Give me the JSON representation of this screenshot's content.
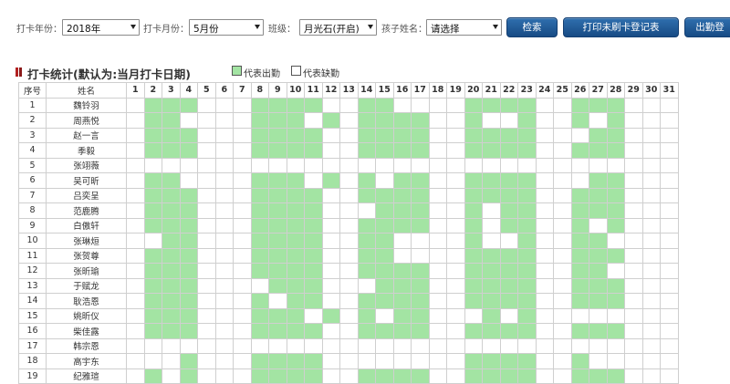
{
  "filters": {
    "year_label": "打卡年份：",
    "year_value": "2018年",
    "month_label": "打卡月份：",
    "month_value": "5月份",
    "class_label": "班级：",
    "class_value": "月光石(开启)",
    "child_label": "孩子姓名：",
    "child_value": "请选择"
  },
  "buttons": {
    "search": "检索",
    "print": "打印未刷卡登记表",
    "attendance": "出勤登"
  },
  "section": {
    "title": "打卡统计(默认为:当月打卡日期)",
    "legend_present": "代表出勤",
    "legend_absent": "代表缺勤"
  },
  "colors": {
    "present": "#a3e4a3",
    "absent": "#ffffff",
    "button": "#1f5c9c"
  },
  "table": {
    "col_index": "序号",
    "col_name": "姓名",
    "days": [
      "1",
      "2",
      "3",
      "4",
      "5",
      "6",
      "7",
      "8",
      "9",
      "10",
      "11",
      "12",
      "13",
      "14",
      "15",
      "16",
      "17",
      "18",
      "19",
      "20",
      "21",
      "22",
      "23",
      "24",
      "25",
      "26",
      "27",
      "28",
      "29",
      "30",
      "31"
    ],
    "rows": [
      {
        "no": "1",
        "name": "魏铃羽",
        "att": "0111000111100110000111100111"
      },
      {
        "no": "2",
        "name": "周燕悦",
        "att": "0110000111010111100100100101"
      },
      {
        "no": "3",
        "name": "赵一言",
        "att": "0111000111100111100111100011"
      },
      {
        "no": "4",
        "name": "季毅",
        "att": "0111000111100111100111100111"
      },
      {
        "no": "5",
        "name": "张翊薇",
        "att": "0000000000000000000000000000"
      },
      {
        "no": "6",
        "name": "吴可昕",
        "att": "0110000111010101100111100011"
      },
      {
        "no": "7",
        "name": "吕奕呈",
        "att": "0111000111100111100111100111"
      },
      {
        "no": "8",
        "name": "范鹿腾",
        "att": "0111000111100011100101100111"
      },
      {
        "no": "9",
        "name": "白傲轩",
        "att": "0111000111100111100101100101"
      },
      {
        "no": "10",
        "name": "张琳烜",
        "att": "0011000111100110000100100110"
      },
      {
        "no": "11",
        "name": "张贺尊",
        "att": "0111000111100110000111100111"
      },
      {
        "no": "12",
        "name": "张昕瑜",
        "att": "0111000111100111100111100110"
      },
      {
        "no": "13",
        "name": "于赋龙",
        "att": "0111000011100011100111100111"
      },
      {
        "no": "14",
        "name": "耿浩恩",
        "att": "0111000101100111100111100111"
      },
      {
        "no": "15",
        "name": "姚昕仪",
        "att": "0111000111010101100010100000"
      },
      {
        "no": "16",
        "name": "柴佳露",
        "att": "0111000111100111100111100111"
      },
      {
        "no": "17",
        "name": "韩宗恩",
        "att": "0000000000000000000000000000"
      },
      {
        "no": "18",
        "name": "高宇东",
        "att": "0001000111100000000111100100"
      },
      {
        "no": "19",
        "name": "纪雅瑄",
        "att": "0101000111100111100111100111"
      }
    ]
  }
}
